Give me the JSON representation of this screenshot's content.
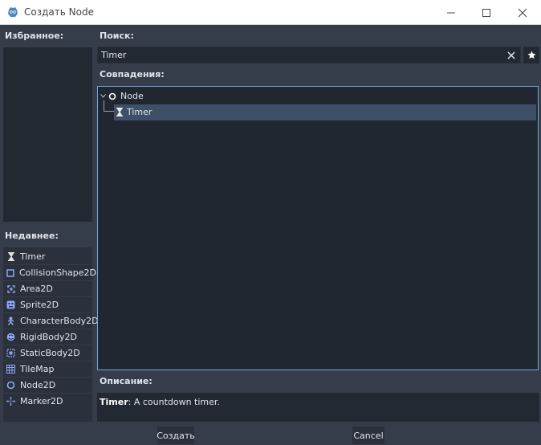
{
  "window": {
    "title": "Создать Node",
    "app_icon": "godot-icon",
    "controls": [
      "minimize-icon",
      "maximize-icon",
      "close-icon"
    ]
  },
  "favorites": {
    "label": "Избранное:",
    "items": []
  },
  "recent": {
    "label": "Недавнее:",
    "items": [
      {
        "label": "Timer",
        "icon": "hourglass-icon"
      },
      {
        "label": "CollisionShape2D",
        "icon": "square-outline-icon"
      },
      {
        "label": "Area2D",
        "icon": "area-bracket-icon"
      },
      {
        "label": "Sprite2D",
        "icon": "sprite-face-icon"
      },
      {
        "label": "CharacterBody2D",
        "icon": "character-icon"
      },
      {
        "label": "RigidBody2D",
        "icon": "rigid-ball-icon"
      },
      {
        "label": "StaticBody2D",
        "icon": "static-square-icon"
      },
      {
        "label": "TileMap",
        "icon": "grid-icon"
      },
      {
        "label": "Node2D",
        "icon": "circle-icon"
      },
      {
        "label": "Marker2D",
        "icon": "crosshair-icon"
      }
    ]
  },
  "search": {
    "label": "Поиск:",
    "value": "Timer"
  },
  "matches": {
    "label": "Совпадения:",
    "tree": [
      {
        "label": "Node",
        "icon": "circle-icon",
        "expanded": true,
        "children": [
          {
            "label": "Timer",
            "icon": "hourglass-icon",
            "selected": true
          }
        ]
      }
    ]
  },
  "description": {
    "label": "Описание:",
    "term": "Timer",
    "text": ": A countdown timer."
  },
  "buttons": {
    "create": "Создать",
    "cancel": "Cancel"
  },
  "colors": {
    "accent": "#6ea8df",
    "selection": "#3e5068",
    "background": "#363d4a"
  }
}
